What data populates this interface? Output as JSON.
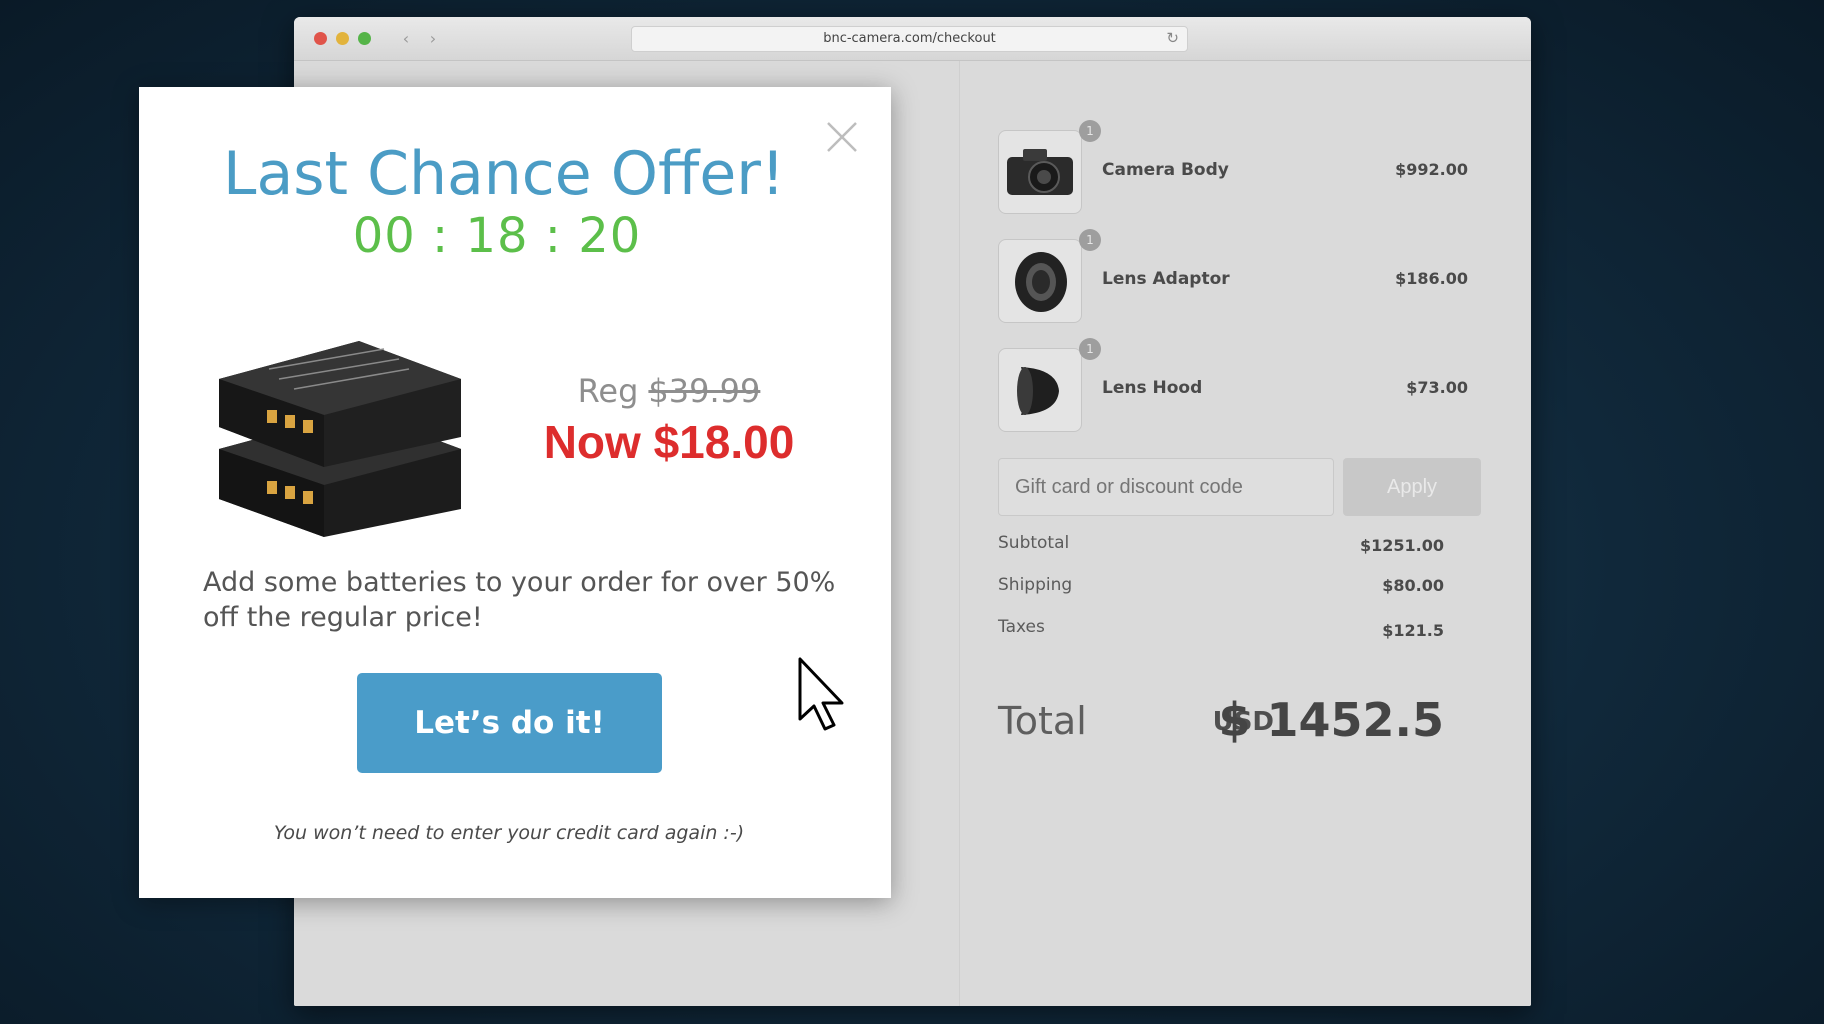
{
  "browser": {
    "url": "bnc-camera.com/checkout"
  },
  "order": {
    "items": [
      {
        "qty": "1",
        "name": "Camera Body",
        "price": "$992.00",
        "icon": "camera-body-icon"
      },
      {
        "qty": "1",
        "name": "Lens Adaptor",
        "price": "$186.00",
        "icon": "lens-adaptor-icon"
      },
      {
        "qty": "1",
        "name": "Lens Hood",
        "price": "$73.00",
        "icon": "lens-hood-icon"
      }
    ],
    "discount": {
      "placeholder": "Gift card or discount code",
      "apply_label": "Apply"
    },
    "summary": {
      "subtotal_label": "Subtotal",
      "subtotal_value": "$1251.00",
      "shipping_label": "Shipping",
      "shipping_value": "$80.00",
      "taxes_label": "Taxes",
      "taxes_value": "$121.5"
    },
    "total": {
      "label": "Total",
      "currency": "USD",
      "value": "$ 1452.5"
    }
  },
  "modal": {
    "title": "Last Chance Offer!",
    "timer": "00 : 18 : 20",
    "reg_label": "Reg",
    "reg_price": "$39.99",
    "now_price": "Now $18.00",
    "description": "Add some batteries to your order for over 50% off the regular price!",
    "cta_label": "Let’s do it!",
    "note": "You won’t need to enter your credit card again :-)",
    "product_icon": "battery-pack-icon"
  },
  "colors": {
    "title": "#4b9cc5",
    "timer": "#5cbf4a",
    "now_price": "#dd2d2d",
    "cta": "#4a9cc9"
  }
}
